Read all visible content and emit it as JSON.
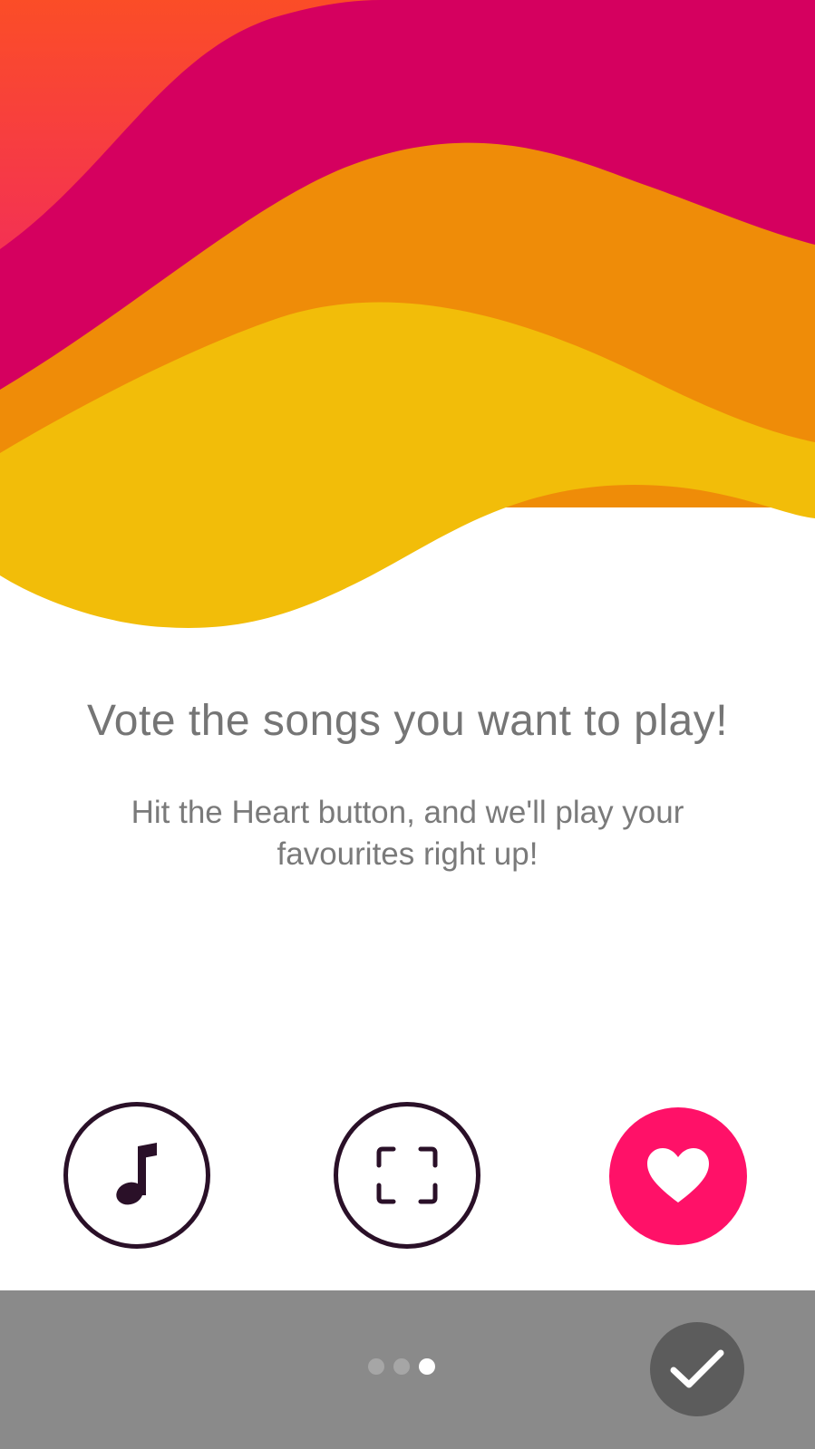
{
  "onboarding": {
    "title": "Vote the songs you want to play!",
    "subtitle": "Hit the Heart button, and we'll play your favourites right up!"
  },
  "icons": [
    {
      "name": "music-note-icon",
      "style": "outline"
    },
    {
      "name": "scan-frame-icon",
      "style": "outline"
    },
    {
      "name": "heart-icon",
      "style": "filled",
      "color": "#ff1168"
    }
  ],
  "pager": {
    "total_pages": 3,
    "current_page": 3
  },
  "colors": {
    "wave_red_orange": "#f94a2c",
    "wave_magenta": "#d5005f",
    "wave_orange": "#ef8c08",
    "wave_yellow": "#f2bd09",
    "heart_accent": "#ff1168",
    "icon_outline": "#2a1028",
    "bottom_bar": "#8a8a8a",
    "done_button": "#5c5c5c"
  }
}
